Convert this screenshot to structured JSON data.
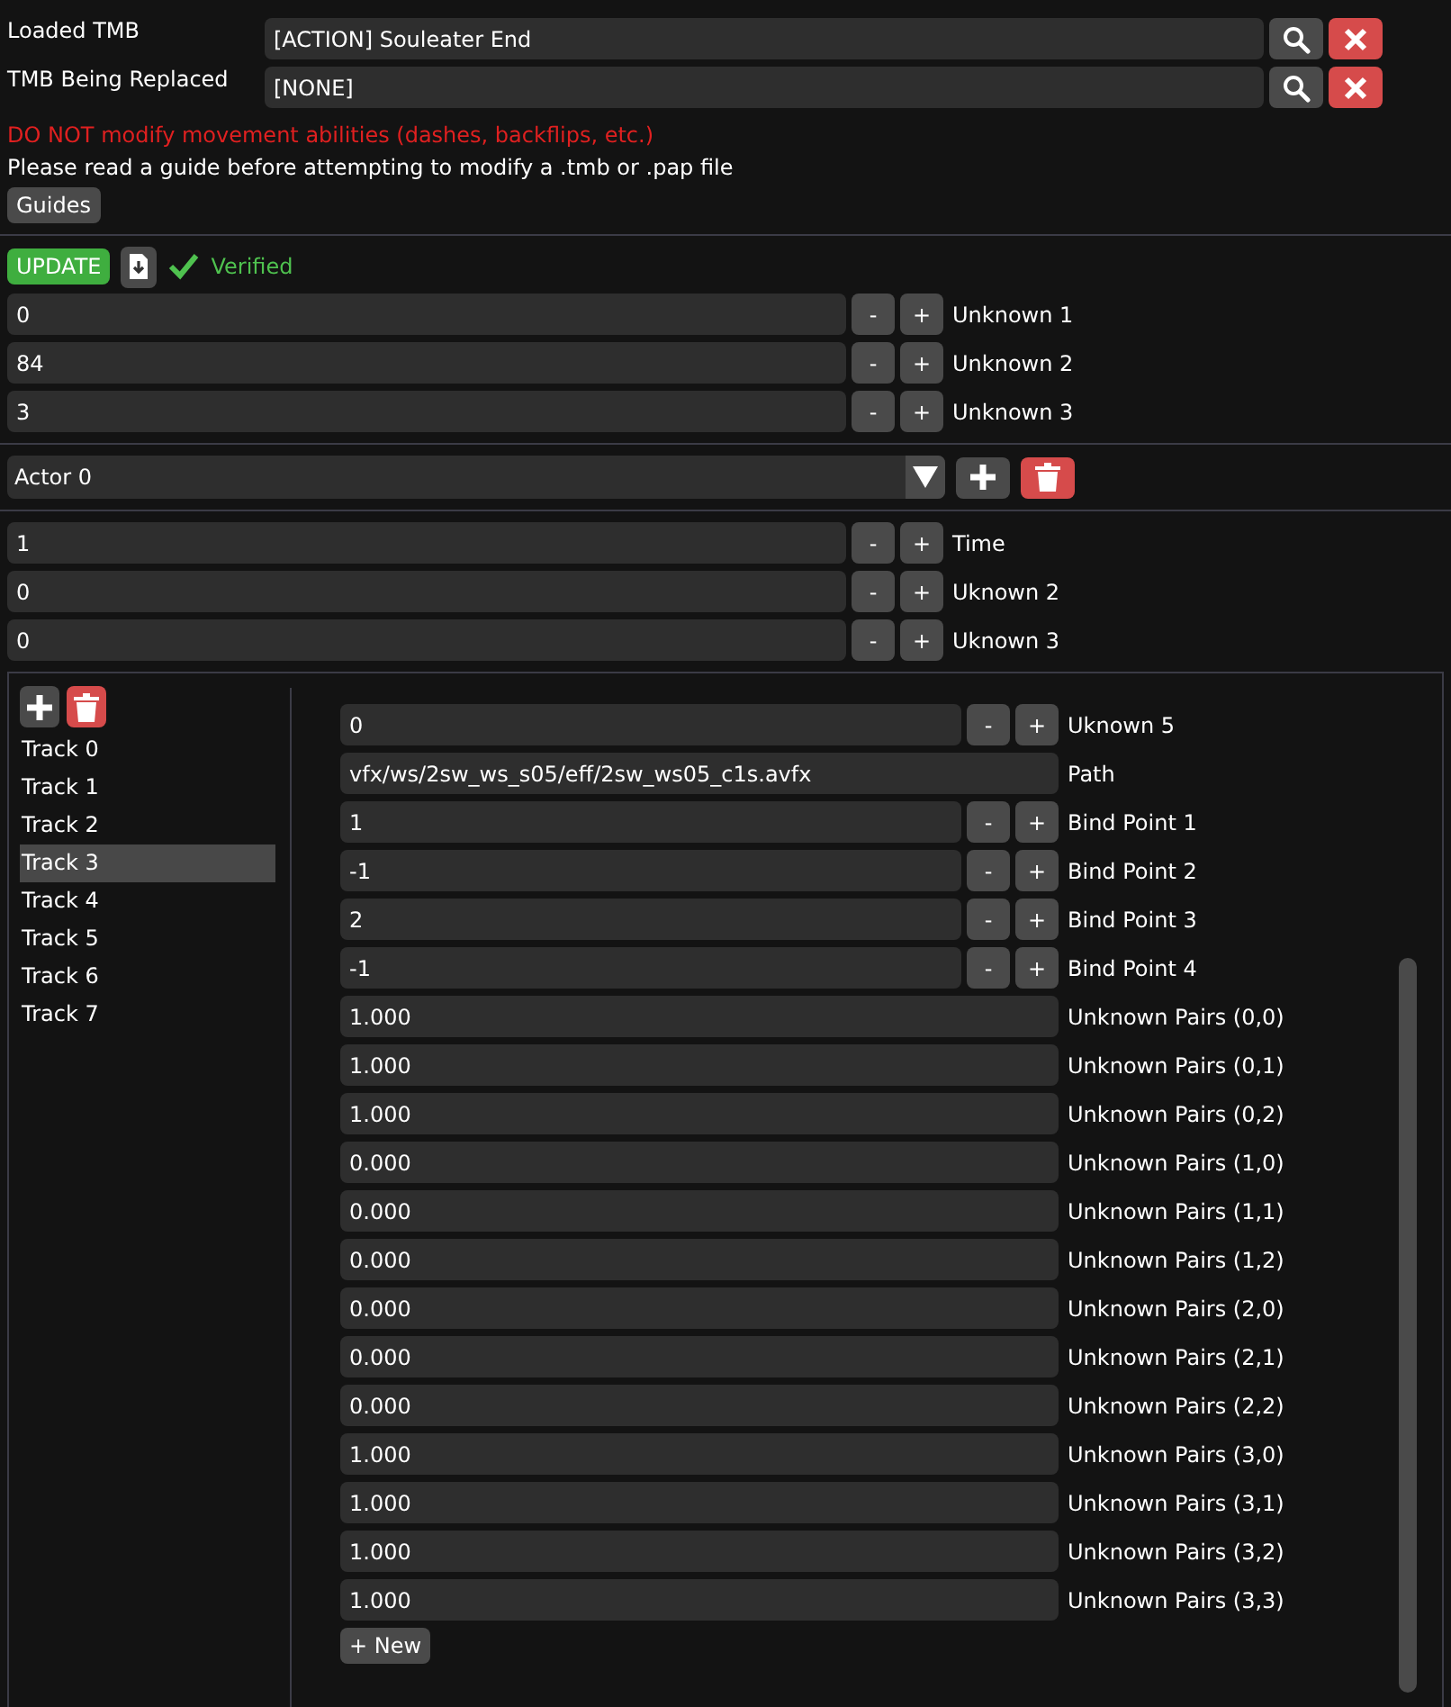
{
  "files": [
    {
      "label": "Loaded TMB",
      "value": "[ACTION] Souleater End"
    },
    {
      "label": "TMB Being Replaced",
      "value": "[NONE]"
    }
  ],
  "warning": "DO NOT modify movement abilities (dashes, backflips, etc.)",
  "guide_text": "Please read a guide before attempting to modify a .tmb or .pap file",
  "guides_button": "Guides",
  "update_button": "UPDATE",
  "status": "Verified",
  "params": [
    {
      "value": "0",
      "decrement": "-",
      "increment": "+",
      "label": "Unknown 1"
    },
    {
      "value": "84",
      "decrement": "-",
      "increment": "+",
      "label": "Unknown 2"
    },
    {
      "value": "3",
      "decrement": "-",
      "increment": "+",
      "label": "Unknown 3"
    }
  ],
  "actor": "Actor 0",
  "actor_params": [
    {
      "value": "1",
      "decrement": "-",
      "increment": "+",
      "label": "Time"
    },
    {
      "value": "0",
      "decrement": "-",
      "increment": "+",
      "label": "Uknown 2"
    },
    {
      "value": "0",
      "decrement": "-",
      "increment": "+",
      "label": "Uknown 3"
    }
  ],
  "tracks": [
    {
      "label": "Track 0",
      "selected": false
    },
    {
      "label": "Track 1",
      "selected": false
    },
    {
      "label": "Track 2",
      "selected": false
    },
    {
      "label": "Track 3",
      "selected": true
    },
    {
      "label": "Track 4",
      "selected": false
    },
    {
      "label": "Track 5",
      "selected": false
    },
    {
      "label": "Track 6",
      "selected": false
    },
    {
      "label": "Track 7",
      "selected": false
    }
  ],
  "track_fields": [
    {
      "kind": "number",
      "value": "0",
      "decrement": "-",
      "increment": "+",
      "label": "Uknown 5"
    },
    {
      "kind": "text",
      "value": "vfx/ws/2sw_ws_s05/eff/2sw_ws05_c1s.avfx",
      "label": "Path"
    },
    {
      "kind": "number",
      "value": "1",
      "decrement": "-",
      "increment": "+",
      "label": "Bind Point 1"
    },
    {
      "kind": "number",
      "value": "-1",
      "decrement": "-",
      "increment": "+",
      "label": "Bind Point 2"
    },
    {
      "kind": "number",
      "value": "2",
      "decrement": "-",
      "increment": "+",
      "label": "Bind Point 3"
    },
    {
      "kind": "number",
      "value": "-1",
      "decrement": "-",
      "increment": "+",
      "label": "Bind Point 4"
    },
    {
      "kind": "text",
      "value": "1.000",
      "label": "Unknown Pairs (0,0)"
    },
    {
      "kind": "text",
      "value": "1.000",
      "label": "Unknown Pairs (0,1)"
    },
    {
      "kind": "text",
      "value": "1.000",
      "label": "Unknown Pairs (0,2)"
    },
    {
      "kind": "text",
      "value": "0.000",
      "label": "Unknown Pairs (1,0)"
    },
    {
      "kind": "text",
      "value": "0.000",
      "label": "Unknown Pairs (1,1)"
    },
    {
      "kind": "text",
      "value": "0.000",
      "label": "Unknown Pairs (1,2)"
    },
    {
      "kind": "text",
      "value": "0.000",
      "label": "Unknown Pairs (2,0)"
    },
    {
      "kind": "text",
      "value": "0.000",
      "label": "Unknown Pairs (2,1)"
    },
    {
      "kind": "text",
      "value": "0.000",
      "label": "Unknown Pairs (2,2)"
    },
    {
      "kind": "text",
      "value": "1.000",
      "label": "Unknown Pairs (3,0)"
    },
    {
      "kind": "text",
      "value": "1.000",
      "label": "Unknown Pairs (3,1)"
    },
    {
      "kind": "text",
      "value": "1.000",
      "label": "Unknown Pairs (3,2)"
    },
    {
      "kind": "text",
      "value": "1.000",
      "label": "Unknown Pairs (3,3)"
    }
  ],
  "new_button": "+ New"
}
